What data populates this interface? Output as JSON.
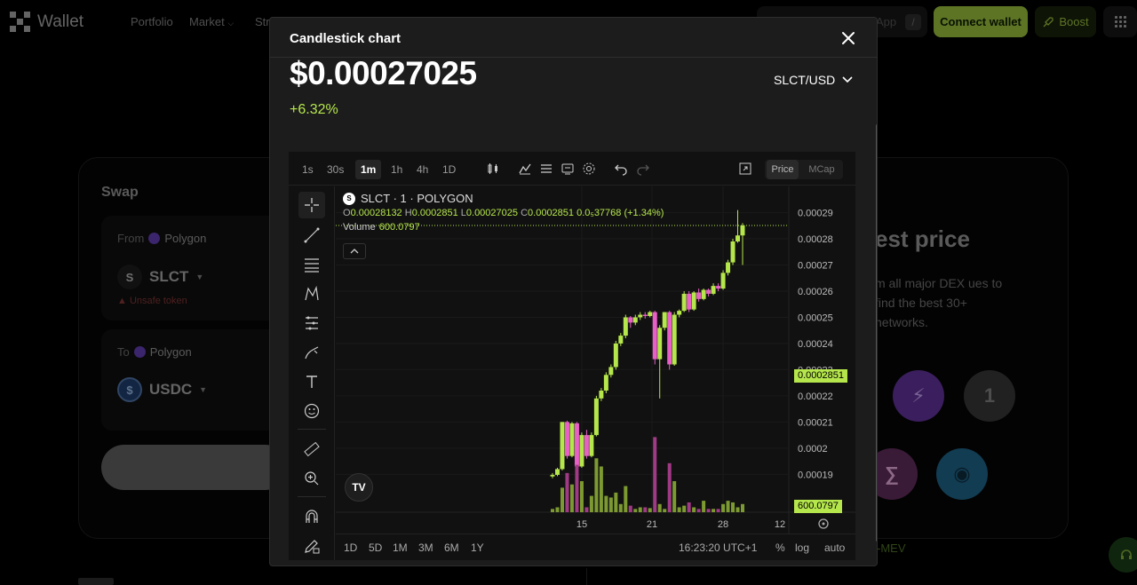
{
  "nav": {
    "logo_text": "Wallet",
    "items": [
      "Portfolio",
      "Market",
      "Str"
    ],
    "search_app": "App",
    "search_shortcut": "/",
    "connect_label": "Connect wallet",
    "boost_label": "Boost"
  },
  "swap": {
    "title": "Swap",
    "from": {
      "label": "From",
      "network": "Polygon",
      "token": "SLCT",
      "icon_letter": "S",
      "warning": "Unsafe token"
    },
    "to": {
      "label": "To",
      "network": "Polygon",
      "token": "USDC",
      "icon_letter": "$"
    }
  },
  "promo": {
    "heading": "est price",
    "desc": "m all major DEX ues to find the best 30+ networks.",
    "mev_label": "-MEV",
    "one_label": "1"
  },
  "modal": {
    "title": "Candlestick chart",
    "price": "$0.00027025",
    "change": "+6.32%",
    "pair": "SLCT/USD"
  },
  "chart_widget": {
    "timeframes": [
      "1s",
      "30s",
      "1m",
      "1h",
      "4h",
      "1D"
    ],
    "active_timeframe": "1m",
    "toggle": [
      "Price",
      "MCap"
    ],
    "active_toggle": "Price",
    "legend_title": "SLCT · 1 · POLYGON",
    "ohlc": {
      "o_label": "O",
      "o": "0.00028132",
      "h_label": "H",
      "h": "0.0002851",
      "l_label": "L",
      "l": "0.00027025",
      "c_label": "C",
      "c": "0.0002851",
      "change": "0.0₅37768 (+1.34%)"
    },
    "volume_label": "Volume",
    "volume_value": "600.0797",
    "last_price_tag": "0.0002851",
    "volume_tag": "600.0797",
    "tv_logo": "TV",
    "ranges": [
      "1D",
      "5D",
      "1M",
      "3M",
      "6M",
      "1Y"
    ],
    "time": "16:23:20 UTC+1",
    "percent": "%",
    "log": "log",
    "auto": "auto"
  },
  "colors": {
    "up": "#b5e64b",
    "down": "#e85fc6",
    "vol_up": "#7c9a31",
    "vol_down": "#a13a85",
    "accent": "#8fb23a"
  },
  "chart_data": {
    "type": "candlestick",
    "y_ticks": [
      "0.00029",
      "0.0002851",
      "0.00028",
      "0.00027",
      "0.00026",
      "0.00025",
      "0.00024",
      "0.00023",
      "0.00022",
      "0.00021",
      "0.0002",
      "0.00019"
    ],
    "x_ticks": [
      "15",
      "21",
      "28",
      "12"
    ],
    "ylim": [
      0.000184,
      0.000298
    ],
    "candles": [
      {
        "o": 0.0001892,
        "h": 0.0001905,
        "l": 0.0001885,
        "c": 0.0001898,
        "v": 0.04
      },
      {
        "o": 0.0001898,
        "h": 0.0001925,
        "l": 0.0001893,
        "c": 0.000192,
        "v": 0.06
      },
      {
        "o": 0.000192,
        "h": 0.00021,
        "l": 0.0001915,
        "c": 0.00021,
        "v": 0.3
      },
      {
        "o": 0.00021,
        "h": 0.0002105,
        "l": 0.000196,
        "c": 0.000197,
        "v": 0.48
      },
      {
        "o": 0.000197,
        "h": 0.00021,
        "l": 0.0001965,
        "c": 0.0002095,
        "v": 0.34
      },
      {
        "o": 0.0002095,
        "h": 0.00021,
        "l": 0.000192,
        "c": 0.000193,
        "v": 0.58
      },
      {
        "o": 0.000193,
        "h": 0.000206,
        "l": 0.0001925,
        "c": 0.000205,
        "v": 0.38
      },
      {
        "o": 0.000205,
        "h": 0.000207,
        "l": 0.000196,
        "c": 0.000197,
        "v": 0.06
      },
      {
        "o": 0.000197,
        "h": 0.000206,
        "l": 0.0001965,
        "c": 0.000205,
        "v": 0.2
      },
      {
        "o": 0.000205,
        "h": 0.00022,
        "l": 0.0002045,
        "c": 0.000219,
        "v": 0.66
      },
      {
        "o": 0.000219,
        "h": 0.000223,
        "l": 0.000218,
        "c": 0.000222,
        "v": 0.56
      },
      {
        "o": 0.000222,
        "h": 0.000229,
        "l": 0.000221,
        "c": 0.000228,
        "v": 0.2
      },
      {
        "o": 0.000228,
        "h": 0.000232,
        "l": 0.000227,
        "c": 0.000231,
        "v": 0.18
      },
      {
        "o": 0.000231,
        "h": 0.000241,
        "l": 0.00023,
        "c": 0.00024,
        "v": 0.24
      },
      {
        "o": 0.00024,
        "h": 0.000244,
        "l": 0.000239,
        "c": 0.000243,
        "v": 0.1
      },
      {
        "o": 0.000243,
        "h": 0.000251,
        "l": 0.000242,
        "c": 0.00025,
        "v": 0.32
      },
      {
        "o": 0.00025,
        "h": 0.0002505,
        "l": 0.000246,
        "c": 0.000248,
        "v": 0.08
      },
      {
        "o": 0.000248,
        "h": 0.000251,
        "l": 0.000247,
        "c": 0.00025,
        "v": 0.04
      },
      {
        "o": 0.00025,
        "h": 0.000252,
        "l": 0.000249,
        "c": 0.000251,
        "v": 0.06
      },
      {
        "o": 0.000251,
        "h": 0.000252,
        "l": 0.0002495,
        "c": 0.0002505,
        "v": 0.06
      },
      {
        "o": 0.0002505,
        "h": 0.0002525,
        "l": 0.00025,
        "c": 0.000252,
        "v": 0.05
      },
      {
        "o": 0.000252,
        "h": 0.0002525,
        "l": 0.000232,
        "c": 0.000234,
        "v": 0.92
      },
      {
        "o": 0.000234,
        "h": 0.000247,
        "l": 0.000219,
        "c": 0.000246,
        "v": 0.1
      },
      {
        "o": 0.000246,
        "h": 0.000252,
        "l": 0.000245,
        "c": 0.000252,
        "v": 0.04
      },
      {
        "o": 0.000252,
        "h": 0.0002525,
        "l": 0.00023,
        "c": 0.000232,
        "v": 0.6
      },
      {
        "o": 0.000232,
        "h": 0.000252,
        "l": 0.0002315,
        "c": 0.000251,
        "v": 0.38
      },
      {
        "o": 0.000251,
        "h": 0.000253,
        "l": 0.00025,
        "c": 0.0002525,
        "v": 0.06
      },
      {
        "o": 0.0002525,
        "h": 0.00026,
        "l": 0.000252,
        "c": 0.000259,
        "v": 0.08
      },
      {
        "o": 0.000259,
        "h": 0.00026,
        "l": 0.000252,
        "c": 0.000253,
        "v": 0.12
      },
      {
        "o": 0.000253,
        "h": 0.00026,
        "l": 0.0002525,
        "c": 0.0002595,
        "v": 0.06
      },
      {
        "o": 0.0002595,
        "h": 0.000261,
        "l": 0.000256,
        "c": 0.000257,
        "v": 0.04
      },
      {
        "o": 0.000257,
        "h": 0.000261,
        "l": 0.0002565,
        "c": 0.0002605,
        "v": 0.14
      },
      {
        "o": 0.0002605,
        "h": 0.000261,
        "l": 0.000258,
        "c": 0.000259,
        "v": 0.04
      },
      {
        "o": 0.000259,
        "h": 0.000263,
        "l": 0.0002585,
        "c": 0.000262,
        "v": 0.04
      },
      {
        "o": 0.000262,
        "h": 0.000263,
        "l": 0.00026,
        "c": 0.000261,
        "v": 0.04
      },
      {
        "o": 0.000261,
        "h": 0.000268,
        "l": 0.0002605,
        "c": 0.000267,
        "v": 0.1
      },
      {
        "o": 0.000267,
        "h": 0.000272,
        "l": 0.000266,
        "c": 0.000271,
        "v": 0.14
      },
      {
        "o": 0.000271,
        "h": 0.00028,
        "l": 0.00027,
        "c": 0.000279,
        "v": 0.12
      },
      {
        "o": 0.000279,
        "h": 0.000291,
        "l": 0.0002785,
        "c": 0.0002813,
        "v": 0.06
      },
      {
        "o": 0.0002813,
        "h": 0.000286,
        "l": 0.00027,
        "c": 0.0002851,
        "v": 0.1
      }
    ]
  }
}
